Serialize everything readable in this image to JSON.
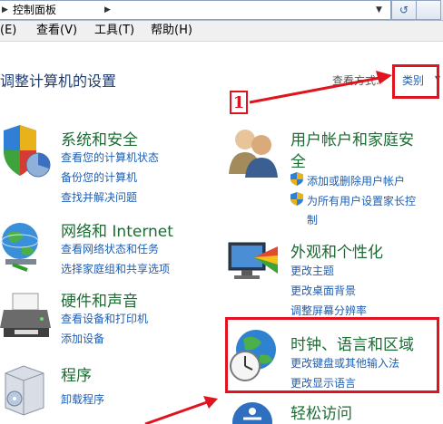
{
  "address_bar": {
    "breadcrumb": "控制面板",
    "refresh_glyph": "↺"
  },
  "menu": [
    "(E)",
    "查看(V)",
    "工具(T)",
    "帮助(H)"
  ],
  "page_title": "调整计算机的设置",
  "view_by": {
    "label": "查看方式:",
    "value": "类别"
  },
  "annotation_marker": "1",
  "categories_left": [
    {
      "title": "系统和安全",
      "links": [
        "查看您的计算机状态",
        "备份您的计算机",
        "查找并解决问题"
      ],
      "icon": "shield-pie-icon"
    },
    {
      "title": "网络和 Internet",
      "links": [
        "查看网络状态和任务",
        "选择家庭组和共享选项"
      ],
      "icon": "network-globe-icon"
    },
    {
      "title": "硬件和声音",
      "links": [
        "查看设备和打印机",
        "添加设备"
      ],
      "icon": "printer-icon"
    },
    {
      "title": "程序",
      "links": [
        "卸载程序"
      ],
      "icon": "programs-box-icon"
    }
  ],
  "categories_right": [
    {
      "title_lines": [
        "用户帐户和家庭安",
        "全"
      ],
      "links": [
        "添加或删除用户帐户",
        "为所有用户设置家长控",
        "制"
      ],
      "icon": "users-icon"
    },
    {
      "title": "外观和个性化",
      "links": [
        "更改主题",
        "更改桌面背景",
        "调整屏幕分辨率"
      ],
      "icon": "monitor-palette-icon"
    },
    {
      "title": "时钟、语言和区域",
      "links": [
        "更改键盘或其他输入法",
        "更改显示语言"
      ],
      "icon": "clock-globe-icon"
    },
    {
      "title": "轻松访问",
      "icon": "ease-of-access-icon"
    }
  ],
  "colors": {
    "highlight": "#e0141e",
    "category_title": "#1c6b34",
    "link": "#1e5fb4"
  }
}
